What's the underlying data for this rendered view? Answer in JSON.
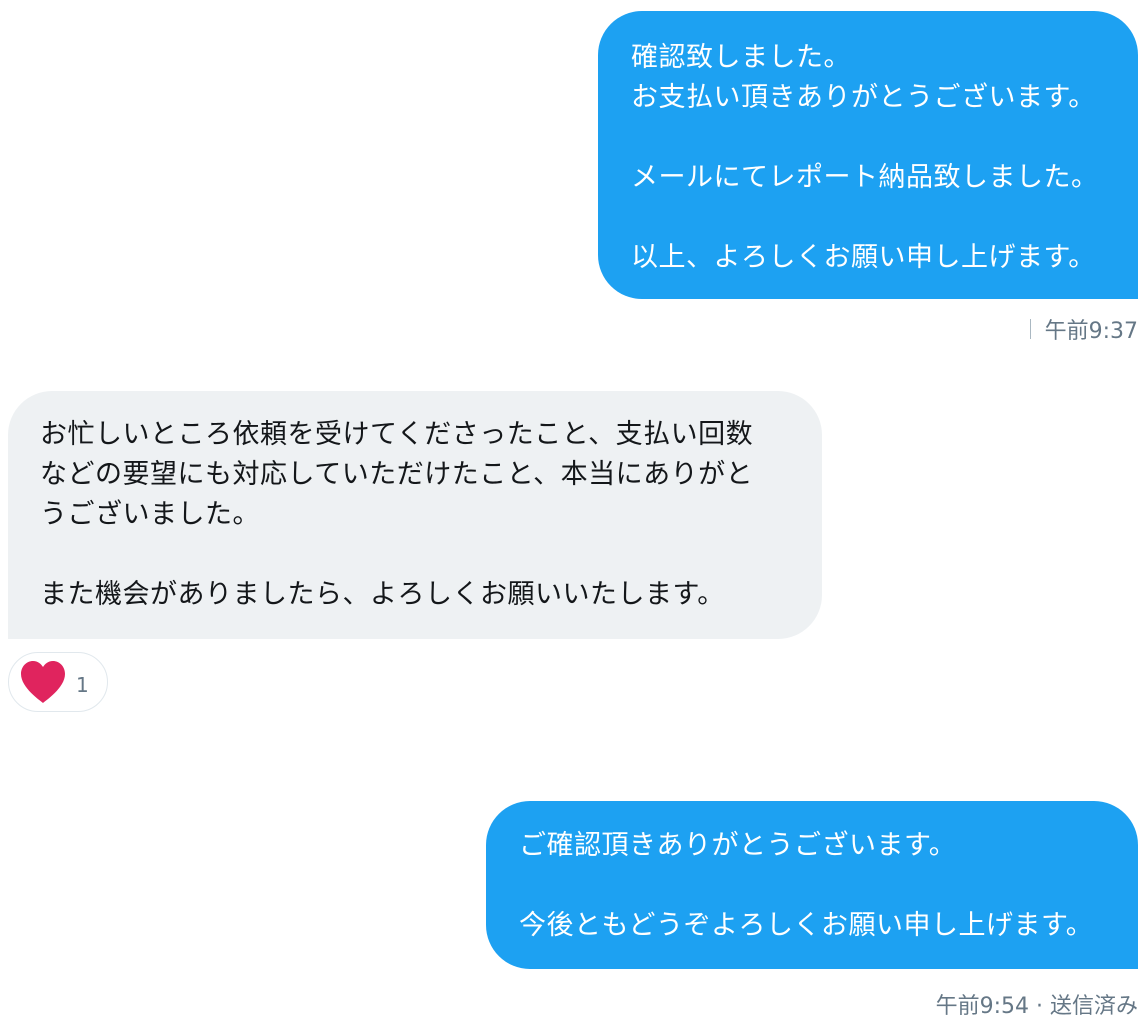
{
  "conversation": {
    "messages": [
      {
        "direction": "sent",
        "text": "確認致しました。\nお支払い頂きありがとうございます。\n\nメールにてレポート納品致しました。\n\n以上、よろしくお願い申し上げます。",
        "timestamp": "午前9:37"
      },
      {
        "direction": "received",
        "text": "お忙しいところ依頼を受けてくださったこと、支払い回数\nなどの要望にも対応していただけたこと、本当にありがと\nうございました。\n\nまた機会がありましたら、よろしくお願いいたします。",
        "reaction": {
          "icon": "heart-icon",
          "color": "#e0245e",
          "count": "1"
        }
      },
      {
        "direction": "sent",
        "text": "ご確認頂きありがとうございます。\n\n今後ともどうぞよろしくお願い申し上げます。",
        "timestamp": "午前9:54 · 送信済み"
      }
    ]
  },
  "colors": {
    "sent_bubble": "#1da1f2",
    "received_bubble": "#eef1f3",
    "timestamp_text": "#657786"
  }
}
